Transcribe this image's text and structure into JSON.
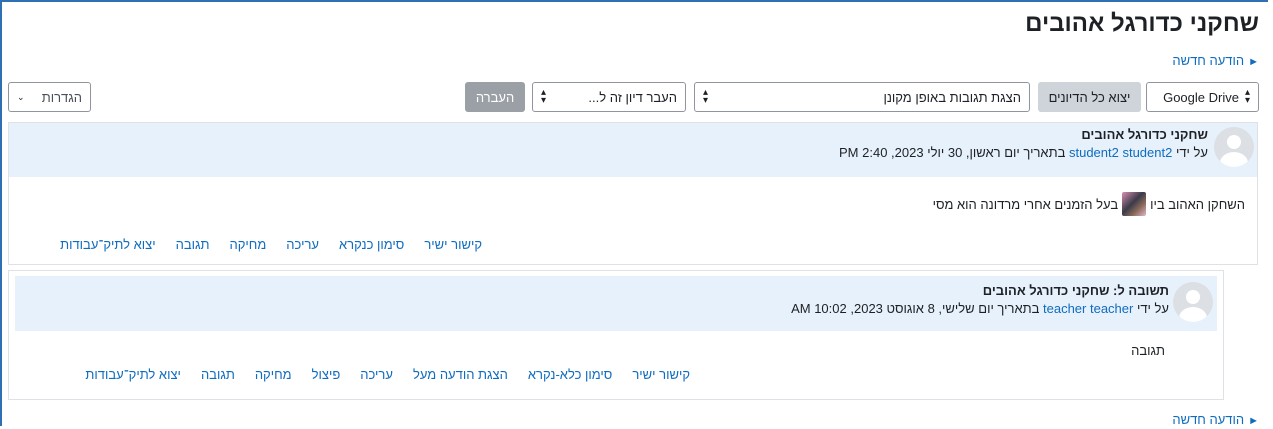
{
  "discussion_title": "שחקני כדורגל אהובים",
  "new_post": "הודעה חדשה",
  "toolbar": {
    "google_drive": "Google Drive",
    "export_all": "יצוא כל הדיונים",
    "display_mode": "הצגת תגובות באופן מקונן",
    "move_to": "העבר דיון זה ל...",
    "move_button": "העברה",
    "settings": "הגדרות"
  },
  "posts": [
    {
      "subject": "שחקני כדורגל אהובים",
      "by_prefix": "על ידי",
      "author": "student2 student2",
      "date": "בתאריך יום ראשון, 30 יולי 2023, 2:40 PM",
      "content_before": "השחקן האהוב ביו",
      "content_after": "בעל הזמנים אחרי מרדונה הוא מסי",
      "actions": [
        "קישור ישיר",
        "סימון כנקרא",
        "עריכה",
        "מחיקה",
        "תגובה",
        "יצוא לתיק־עבודות"
      ]
    },
    {
      "subject": "תשובה ל: שחקני כדורגל אהובים",
      "by_prefix": "על ידי",
      "author": "teacher teacher",
      "date": "בתאריך יום שלישי, 8 אוגוסט 2023, 10:02 AM",
      "content": "תגובה",
      "actions": [
        "קישור ישיר",
        "סימון כלא-נקרא",
        "הצגת הודעה מעל",
        "עריכה",
        "פיצול",
        "מחיקה",
        "תגובה",
        "יצוא לתיק־עבודות"
      ]
    }
  ]
}
